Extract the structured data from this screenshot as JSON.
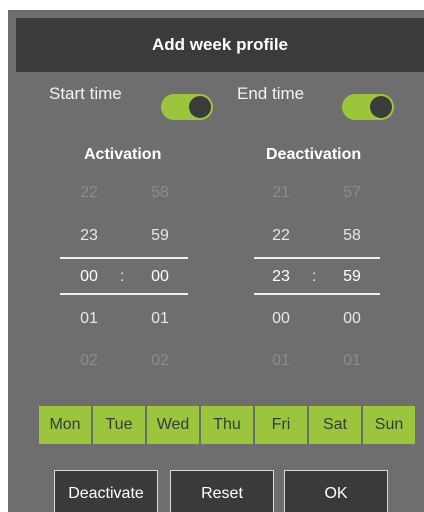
{
  "dialog": {
    "title": "Add week profile",
    "start_time_label": "Start time",
    "end_time_label": "End time",
    "start_time_enabled": true,
    "end_time_enabled": true,
    "activation_label": "Activation",
    "deactivation_label": "Deactivation"
  },
  "activation": {
    "hours": [
      "22",
      "23",
      "00",
      "01",
      "02"
    ],
    "minutes": [
      "58",
      "59",
      "00",
      "01",
      "02"
    ],
    "separator": ":"
  },
  "deactivation": {
    "hours": [
      "21",
      "22",
      "23",
      "00",
      "01"
    ],
    "minutes": [
      "57",
      "58",
      "59",
      "00",
      "01"
    ],
    "separator": ":"
  },
  "days": [
    "Mon",
    "Tue",
    "Wed",
    "Thu",
    "Fri",
    "Sat",
    "Sun"
  ],
  "buttons": {
    "deactivate": "Deactivate",
    "reset": "Reset",
    "ok": "OK"
  },
  "colors": {
    "accent_green": "#9bc53d",
    "dialog_bg": "#6e6e6e",
    "title_bar_bg": "#3b3b3b",
    "button_bg": "#3a3a3a"
  }
}
